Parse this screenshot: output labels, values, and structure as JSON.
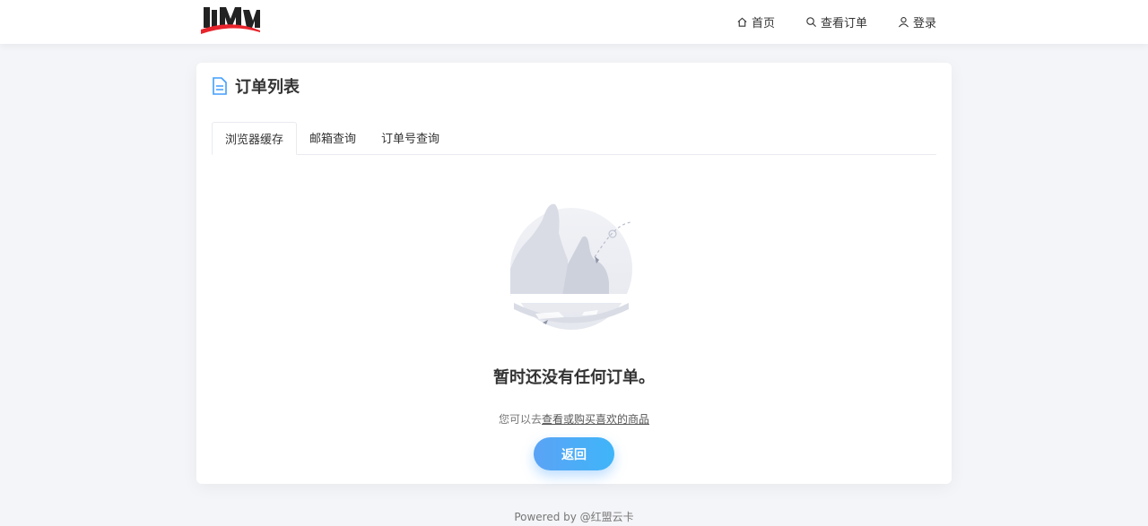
{
  "header": {
    "nav": {
      "home": "首页",
      "view_orders": "查看订单",
      "login": "登录"
    }
  },
  "card": {
    "title": "订单列表",
    "tabs": [
      "浏览器缓存",
      "邮箱查询",
      "订单号查询"
    ],
    "active_tab": "浏览器缓存",
    "empty": {
      "title": "暂时还没有任何订单。",
      "sub_prefix": "您可以去",
      "sub_link": "查看或购买喜欢的商品",
      "button": "返回"
    }
  },
  "footer": {
    "text": "Powered by @红盟云卡"
  },
  "colors": {
    "accent": "#409eff",
    "logo_red": "#e8242c"
  }
}
